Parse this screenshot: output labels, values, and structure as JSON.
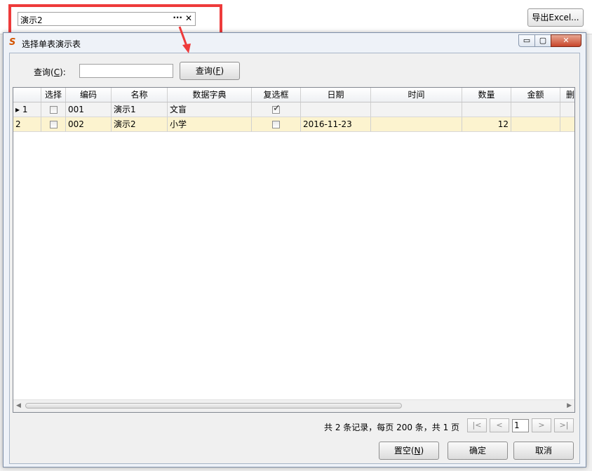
{
  "lookup_field": {
    "value": "演示2",
    "ellipsis": "···",
    "clear": "✕"
  },
  "export_button": "导出Excel...",
  "dialog": {
    "title": "选择单表演示表",
    "window_buttons": {
      "minimize": "▭",
      "maximize": "▢",
      "close": "✕"
    },
    "query": {
      "label_prefix": "查询(",
      "label_key": "C",
      "label_suffix": "):",
      "button_prefix": "查询(",
      "button_key": "F",
      "button_suffix": ")",
      "value": ""
    },
    "grid": {
      "columns": [
        "选择",
        "编码",
        "名称",
        "数据字典",
        "复选框",
        "日期",
        "时间",
        "数量",
        "金额",
        "删"
      ],
      "rows": [
        {
          "row_num": "1",
          "current": true,
          "select": false,
          "code": "001",
          "name": "演示1",
          "dict": "文盲",
          "checkbox": true,
          "date": "",
          "time": "",
          "qty": "",
          "amount": ""
        },
        {
          "row_num": "2",
          "current": false,
          "select": false,
          "code": "002",
          "name": "演示2",
          "dict": "小学",
          "checkbox": false,
          "date": "2016-11-23",
          "time": "",
          "qty": "12",
          "amount": ""
        }
      ]
    },
    "pager": {
      "summary": "共 2 条记录，每页 200 条，共 1 页",
      "first": "|<",
      "prev": "<",
      "page": "1",
      "next": ">",
      "last": ">|"
    },
    "footer": {
      "clear_prefix": "置空(",
      "clear_key": "N",
      "clear_suffix": ")",
      "confirm": "确定",
      "cancel": "取消"
    }
  },
  "colors": {
    "highlight_row": "#fcf3cf",
    "annotation": "#ee3b3b"
  }
}
